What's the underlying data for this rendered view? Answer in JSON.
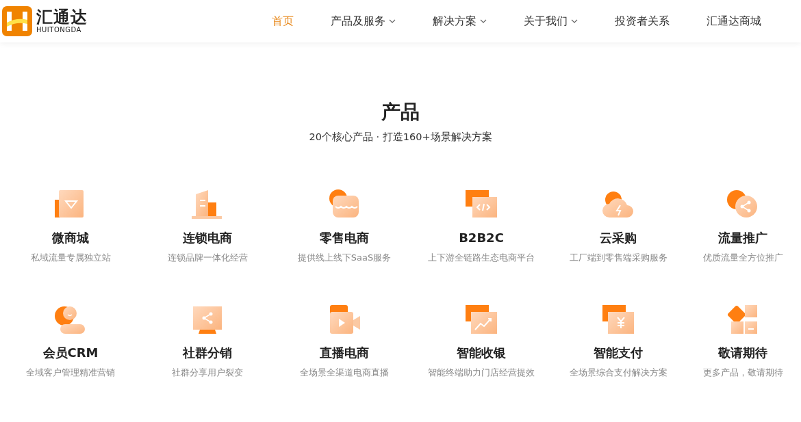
{
  "header": {
    "logo": {
      "name": "汇通达",
      "latin": "HUITONGDA"
    },
    "nav": [
      {
        "label": "首页",
        "selected": true,
        "dropdown": false
      },
      {
        "label": "产品及服务",
        "selected": false,
        "dropdown": true
      },
      {
        "label": "解决方案",
        "selected": false,
        "dropdown": true
      },
      {
        "label": "关于我们",
        "selected": false,
        "dropdown": true
      },
      {
        "label": "投资者关系",
        "selected": false,
        "dropdown": false
      },
      {
        "label": "汇通达商城",
        "selected": false,
        "dropdown": false
      }
    ]
  },
  "section": {
    "title": "产品",
    "subtitle": "20个核心产品 · 打造160+场景解决方案",
    "products": [
      {
        "name": "微商城",
        "description": "私域流量专属独立站"
      },
      {
        "name": "连锁电商",
        "description": "连锁品牌一体化经营"
      },
      {
        "name": "零售电商",
        "description": "提供线上线下SaaS服务"
      },
      {
        "name": "B2B2C",
        "description": "上下游全链路生态电商平台"
      },
      {
        "name": "云采购",
        "description": "工厂端到零售端采购服务"
      },
      {
        "name": "流量推广",
        "description": "优质流量全方位推广"
      },
      {
        "name": "会员CRM",
        "description": "全域客户管理精准营销"
      },
      {
        "name": "社群分销",
        "description": "社群分享用户裂变"
      },
      {
        "name": "直播电商",
        "description": "全场景全渠道电商直播"
      },
      {
        "name": "智能收银",
        "description": "智能终端助力门店经营提效"
      },
      {
        "name": "智能支付",
        "description": "全场景综合支付解决方案"
      },
      {
        "name": "敬请期待",
        "description": "更多产品，敬请期待"
      }
    ]
  }
}
